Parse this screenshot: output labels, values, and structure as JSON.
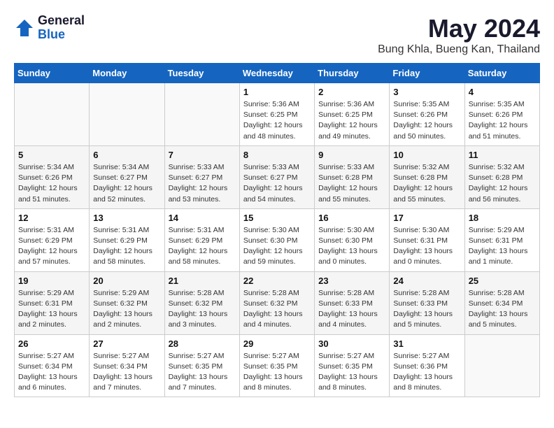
{
  "header": {
    "logo_general": "General",
    "logo_blue": "Blue",
    "month_title": "May 2024",
    "location": "Bung Khla, Bueng Kan, Thailand"
  },
  "weekdays": [
    "Sunday",
    "Monday",
    "Tuesday",
    "Wednesday",
    "Thursday",
    "Friday",
    "Saturday"
  ],
  "weeks": [
    [
      {
        "day": "",
        "empty": true
      },
      {
        "day": "",
        "empty": true
      },
      {
        "day": "",
        "empty": true
      },
      {
        "day": "1",
        "sunrise": "Sunrise: 5:36 AM",
        "sunset": "Sunset: 6:25 PM",
        "daylight": "Daylight: 12 hours and 48 minutes."
      },
      {
        "day": "2",
        "sunrise": "Sunrise: 5:36 AM",
        "sunset": "Sunset: 6:25 PM",
        "daylight": "Daylight: 12 hours and 49 minutes."
      },
      {
        "day": "3",
        "sunrise": "Sunrise: 5:35 AM",
        "sunset": "Sunset: 6:26 PM",
        "daylight": "Daylight: 12 hours and 50 minutes."
      },
      {
        "day": "4",
        "sunrise": "Sunrise: 5:35 AM",
        "sunset": "Sunset: 6:26 PM",
        "daylight": "Daylight: 12 hours and 51 minutes."
      }
    ],
    [
      {
        "day": "5",
        "sunrise": "Sunrise: 5:34 AM",
        "sunset": "Sunset: 6:26 PM",
        "daylight": "Daylight: 12 hours and 51 minutes."
      },
      {
        "day": "6",
        "sunrise": "Sunrise: 5:34 AM",
        "sunset": "Sunset: 6:27 PM",
        "daylight": "Daylight: 12 hours and 52 minutes."
      },
      {
        "day": "7",
        "sunrise": "Sunrise: 5:33 AM",
        "sunset": "Sunset: 6:27 PM",
        "daylight": "Daylight: 12 hours and 53 minutes."
      },
      {
        "day": "8",
        "sunrise": "Sunrise: 5:33 AM",
        "sunset": "Sunset: 6:27 PM",
        "daylight": "Daylight: 12 hours and 54 minutes."
      },
      {
        "day": "9",
        "sunrise": "Sunrise: 5:33 AM",
        "sunset": "Sunset: 6:28 PM",
        "daylight": "Daylight: 12 hours and 55 minutes."
      },
      {
        "day": "10",
        "sunrise": "Sunrise: 5:32 AM",
        "sunset": "Sunset: 6:28 PM",
        "daylight": "Daylight: 12 hours and 55 minutes."
      },
      {
        "day": "11",
        "sunrise": "Sunrise: 5:32 AM",
        "sunset": "Sunset: 6:28 PM",
        "daylight": "Daylight: 12 hours and 56 minutes."
      }
    ],
    [
      {
        "day": "12",
        "sunrise": "Sunrise: 5:31 AM",
        "sunset": "Sunset: 6:29 PM",
        "daylight": "Daylight: 12 hours and 57 minutes."
      },
      {
        "day": "13",
        "sunrise": "Sunrise: 5:31 AM",
        "sunset": "Sunset: 6:29 PM",
        "daylight": "Daylight: 12 hours and 58 minutes."
      },
      {
        "day": "14",
        "sunrise": "Sunrise: 5:31 AM",
        "sunset": "Sunset: 6:29 PM",
        "daylight": "Daylight: 12 hours and 58 minutes."
      },
      {
        "day": "15",
        "sunrise": "Sunrise: 5:30 AM",
        "sunset": "Sunset: 6:30 PM",
        "daylight": "Daylight: 12 hours and 59 minutes."
      },
      {
        "day": "16",
        "sunrise": "Sunrise: 5:30 AM",
        "sunset": "Sunset: 6:30 PM",
        "daylight": "Daylight: 13 hours and 0 minutes."
      },
      {
        "day": "17",
        "sunrise": "Sunrise: 5:30 AM",
        "sunset": "Sunset: 6:31 PM",
        "daylight": "Daylight: 13 hours and 0 minutes."
      },
      {
        "day": "18",
        "sunrise": "Sunrise: 5:29 AM",
        "sunset": "Sunset: 6:31 PM",
        "daylight": "Daylight: 13 hours and 1 minute."
      }
    ],
    [
      {
        "day": "19",
        "sunrise": "Sunrise: 5:29 AM",
        "sunset": "Sunset: 6:31 PM",
        "daylight": "Daylight: 13 hours and 2 minutes."
      },
      {
        "day": "20",
        "sunrise": "Sunrise: 5:29 AM",
        "sunset": "Sunset: 6:32 PM",
        "daylight": "Daylight: 13 hours and 2 minutes."
      },
      {
        "day": "21",
        "sunrise": "Sunrise: 5:28 AM",
        "sunset": "Sunset: 6:32 PM",
        "daylight": "Daylight: 13 hours and 3 minutes."
      },
      {
        "day": "22",
        "sunrise": "Sunrise: 5:28 AM",
        "sunset": "Sunset: 6:32 PM",
        "daylight": "Daylight: 13 hours and 4 minutes."
      },
      {
        "day": "23",
        "sunrise": "Sunrise: 5:28 AM",
        "sunset": "Sunset: 6:33 PM",
        "daylight": "Daylight: 13 hours and 4 minutes."
      },
      {
        "day": "24",
        "sunrise": "Sunrise: 5:28 AM",
        "sunset": "Sunset: 6:33 PM",
        "daylight": "Daylight: 13 hours and 5 minutes."
      },
      {
        "day": "25",
        "sunrise": "Sunrise: 5:28 AM",
        "sunset": "Sunset: 6:34 PM",
        "daylight": "Daylight: 13 hours and 5 minutes."
      }
    ],
    [
      {
        "day": "26",
        "sunrise": "Sunrise: 5:27 AM",
        "sunset": "Sunset: 6:34 PM",
        "daylight": "Daylight: 13 hours and 6 minutes."
      },
      {
        "day": "27",
        "sunrise": "Sunrise: 5:27 AM",
        "sunset": "Sunset: 6:34 PM",
        "daylight": "Daylight: 13 hours and 7 minutes."
      },
      {
        "day": "28",
        "sunrise": "Sunrise: 5:27 AM",
        "sunset": "Sunset: 6:35 PM",
        "daylight": "Daylight: 13 hours and 7 minutes."
      },
      {
        "day": "29",
        "sunrise": "Sunrise: 5:27 AM",
        "sunset": "Sunset: 6:35 PM",
        "daylight": "Daylight: 13 hours and 8 minutes."
      },
      {
        "day": "30",
        "sunrise": "Sunrise: 5:27 AM",
        "sunset": "Sunset: 6:35 PM",
        "daylight": "Daylight: 13 hours and 8 minutes."
      },
      {
        "day": "31",
        "sunrise": "Sunrise: 5:27 AM",
        "sunset": "Sunset: 6:36 PM",
        "daylight": "Daylight: 13 hours and 8 minutes."
      },
      {
        "day": "",
        "empty": true
      }
    ]
  ]
}
